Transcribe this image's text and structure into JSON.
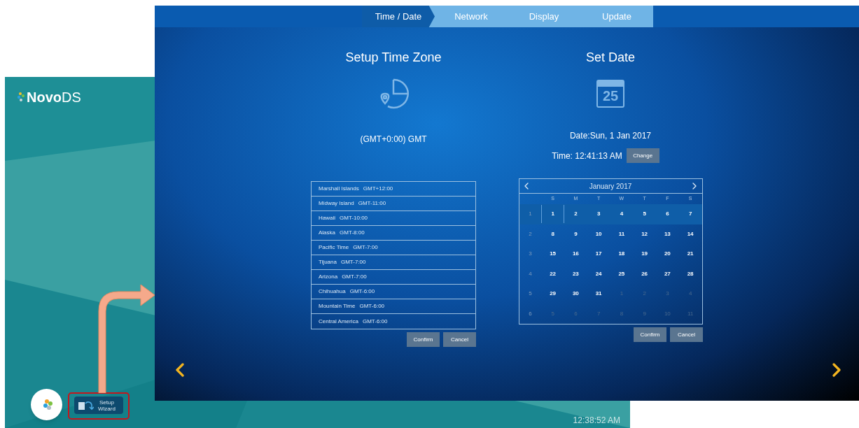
{
  "back_screen": {
    "logo": "**Novo**DS",
    "setup_button": {
      "lines": [
        "Setup",
        "Wizard"
      ],
      "highlighted": true
    },
    "clock": "12:38:52 AM"
  },
  "wizard": {
    "tabs": [
      {
        "label": "Time / Date",
        "selected": true
      },
      {
        "label": "Network",
        "selected": false
      },
      {
        "label": "Display",
        "selected": false
      },
      {
        "label": "Update",
        "selected": false
      }
    ],
    "time_zone": {
      "title": "Setup Time Zone",
      "current": "(GMT+0:00) GMT",
      "zones": [
        {
          "name": "Marshall Islands",
          "offset": "GMT+12:00"
        },
        {
          "name": "Midway Island",
          "offset": "GMT-11:00"
        },
        {
          "name": "Hawaii",
          "offset": "GMT-10:00"
        },
        {
          "name": "Alaska",
          "offset": "GMT-8:00"
        },
        {
          "name": "Pacific Time",
          "offset": "GMT-7:00"
        },
        {
          "name": "Tijuana",
          "offset": "GMT-7:00"
        },
        {
          "name": "Arizona",
          "offset": "GMT-7:00"
        },
        {
          "name": "Chihuahua",
          "offset": "GMT-6:00"
        },
        {
          "name": "Mountain Time",
          "offset": "GMT-6:00"
        },
        {
          "name": "Central America",
          "offset": "GMT-6:00"
        }
      ],
      "buttons": [
        "Confirm",
        "Cancel"
      ]
    },
    "date": {
      "title": "Set Date",
      "icon_day": "25",
      "date_line": "Date:Sun, 1 Jan 2017",
      "time_line": "Time: 12:41:13 AM",
      "change_button": "Change",
      "calendar": {
        "month": "January 2017",
        "weekdays": [
          "S",
          "M",
          "T",
          "W",
          "T",
          "F",
          "S"
        ],
        "weeks": [
          {
            "number": "1",
            "selected": true,
            "days": [
              {
                "day": "1",
                "in_month": true,
                "selected": true
              },
              {
                "day": "2",
                "in_month": true,
                "selected": false
              },
              {
                "day": "3",
                "in_month": true,
                "selected": false
              },
              {
                "day": "4",
                "in_month": true,
                "selected": false
              },
              {
                "day": "5",
                "in_month": true,
                "selected": false
              },
              {
                "day": "6",
                "in_month": true,
                "selected": false
              },
              {
                "day": "7",
                "in_month": true,
                "selected": false
              }
            ]
          },
          {
            "number": "2",
            "selected": false,
            "days": [
              {
                "day": "8",
                "in_month": true,
                "selected": false
              },
              {
                "day": "9",
                "in_month": true,
                "selected": false
              },
              {
                "day": "10",
                "in_month": true,
                "selected": false
              },
              {
                "day": "11",
                "in_month": true,
                "selected": false
              },
              {
                "day": "12",
                "in_month": true,
                "selected": false
              },
              {
                "day": "13",
                "in_month": true,
                "selected": false
              },
              {
                "day": "14",
                "in_month": true,
                "selected": false
              }
            ]
          },
          {
            "number": "3",
            "selected": false,
            "days": [
              {
                "day": "15",
                "in_month": true,
                "selected": false
              },
              {
                "day": "16",
                "in_month": true,
                "selected": false
              },
              {
                "day": "17",
                "in_month": true,
                "selected": false
              },
              {
                "day": "18",
                "in_month": true,
                "selected": false
              },
              {
                "day": "19",
                "in_month": true,
                "selected": false
              },
              {
                "day": "20",
                "in_month": true,
                "selected": false
              },
              {
                "day": "21",
                "in_month": true,
                "selected": false
              }
            ]
          },
          {
            "number": "4",
            "selected": false,
            "days": [
              {
                "day": "22",
                "in_month": true,
                "selected": false
              },
              {
                "day": "23",
                "in_month": true,
                "selected": false
              },
              {
                "day": "24",
                "in_month": true,
                "selected": false
              },
              {
                "day": "25",
                "in_month": true,
                "selected": false
              },
              {
                "day": "26",
                "in_month": true,
                "selected": false
              },
              {
                "day": "27",
                "in_month": true,
                "selected": false
              },
              {
                "day": "28",
                "in_month": true,
                "selected": false
              }
            ]
          },
          {
            "number": "5",
            "selected": false,
            "days": [
              {
                "day": "29",
                "in_month": true,
                "selected": false
              },
              {
                "day": "30",
                "in_month": true,
                "selected": false
              },
              {
                "day": "31",
                "in_month": true,
                "selected": false
              },
              {
                "day": "1",
                "in_month": false,
                "selected": false
              },
              {
                "day": "2",
                "in_month": false,
                "selected": false
              },
              {
                "day": "3",
                "in_month": false,
                "selected": false
              },
              {
                "day": "4",
                "in_month": false,
                "selected": false
              }
            ]
          },
          {
            "number": "6",
            "selected": false,
            "days": [
              {
                "day": "5",
                "in_month": false,
                "selected": false
              },
              {
                "day": "6",
                "in_month": false,
                "selected": false
              },
              {
                "day": "7",
                "in_month": false,
                "selected": false
              },
              {
                "day": "8",
                "in_month": false,
                "selected": false
              },
              {
                "day": "9",
                "in_month": false,
                "selected": false
              },
              {
                "day": "10",
                "in_month": false,
                "selected": false
              },
              {
                "day": "11",
                "in_month": false,
                "selected": false
              }
            ]
          }
        ]
      },
      "buttons": [
        "Confirm",
        "Cancel"
      ]
    }
  }
}
